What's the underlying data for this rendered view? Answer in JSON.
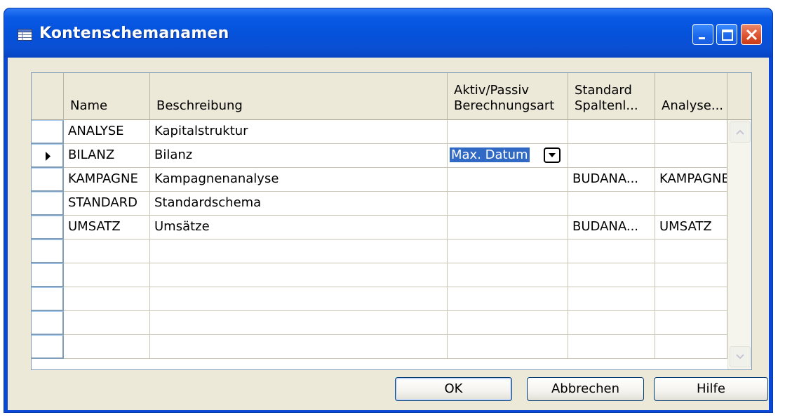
{
  "window": {
    "title": "Kontenschemanamen"
  },
  "columns": [
    {
      "line1": "",
      "line2": "Name"
    },
    {
      "line1": "",
      "line2": "Beschreibung"
    },
    {
      "line1": "Aktiv/Passiv",
      "line2": "Berechnungsart"
    },
    {
      "line1": "Standard",
      "line2": "Spaltenl..."
    },
    {
      "line1": "",
      "line2": "Analyse..."
    }
  ],
  "rows": [
    {
      "name": "ANALYSE",
      "beschreibung": "Kapitalstruktur",
      "berechnungsart": "",
      "spalten": "",
      "analyse": ""
    },
    {
      "name": "BILANZ",
      "beschreibung": "Bilanz",
      "berechnungsart": "Max. Datum",
      "spalten": "",
      "analyse": ""
    },
    {
      "name": "KAMPAGNE",
      "beschreibung": "Kampagnenanalyse",
      "berechnungsart": "",
      "spalten": "BUDANA...",
      "analyse": "KAMPAGNE"
    },
    {
      "name": "STANDARD",
      "beschreibung": "Standardschema",
      "berechnungsart": "",
      "spalten": "",
      "analyse": ""
    },
    {
      "name": "UMSATZ",
      "beschreibung": "Umsätze",
      "berechnungsart": "",
      "spalten": "BUDANA...",
      "analyse": "UMSATZ"
    }
  ],
  "buttons": {
    "ok": "OK",
    "cancel": "Abbrechen",
    "help": "Hilfe"
  },
  "colors": {
    "titlebar": "#0552db",
    "selection": "#316ac5",
    "dialog_bg": "#ece9d8"
  },
  "icons": [
    "table-icon",
    "minimize-icon",
    "maximize-icon",
    "close-icon",
    "row-pointer-icon",
    "dropdown-icon",
    "scroll-up-icon",
    "scroll-down-icon"
  ]
}
